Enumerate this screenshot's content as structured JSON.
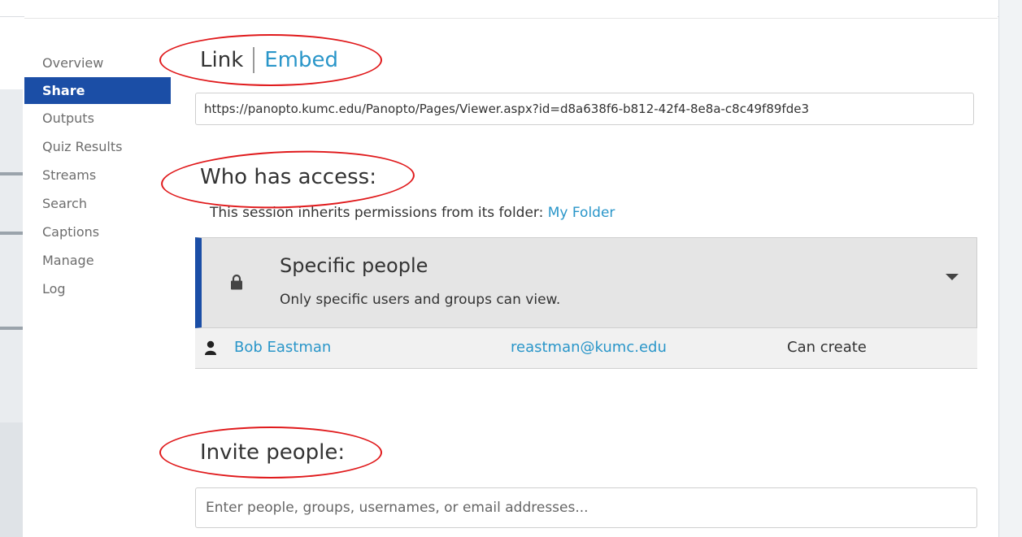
{
  "sidebar": {
    "items": [
      {
        "label": "Overview"
      },
      {
        "label": "Share"
      },
      {
        "label": "Outputs"
      },
      {
        "label": "Quiz Results"
      },
      {
        "label": "Streams"
      },
      {
        "label": "Search"
      },
      {
        "label": "Captions"
      },
      {
        "label": "Manage"
      },
      {
        "label": "Log"
      }
    ],
    "active": "Share"
  },
  "tabs": {
    "link": "Link",
    "embed": "Embed"
  },
  "share_url": "https://panopto.kumc.edu/Panopto/Pages/Viewer.aspx?id=d8a638f6-b812-42f4-8e8a-c8c49f89fde3",
  "access": {
    "heading": "Who has access:",
    "inherit_text": "This session inherits permissions from its folder: ",
    "folder_link": "My Folder",
    "level_title": "Specific people",
    "level_desc": "Only specific users and groups can view.",
    "users": [
      {
        "name": "Bob Eastman",
        "email": "reastman@kumc.edu",
        "role": "Can create"
      }
    ]
  },
  "invite": {
    "heading": "Invite people:",
    "placeholder": "Enter people, groups, usernames, or email addresses..."
  },
  "colors": {
    "accent": "#1b4ea6",
    "link": "#2a96c9",
    "annotation": "#e0191b"
  },
  "icons": {
    "lock": "lock-icon",
    "person": "person-icon",
    "caret": "chevron-down-icon"
  }
}
